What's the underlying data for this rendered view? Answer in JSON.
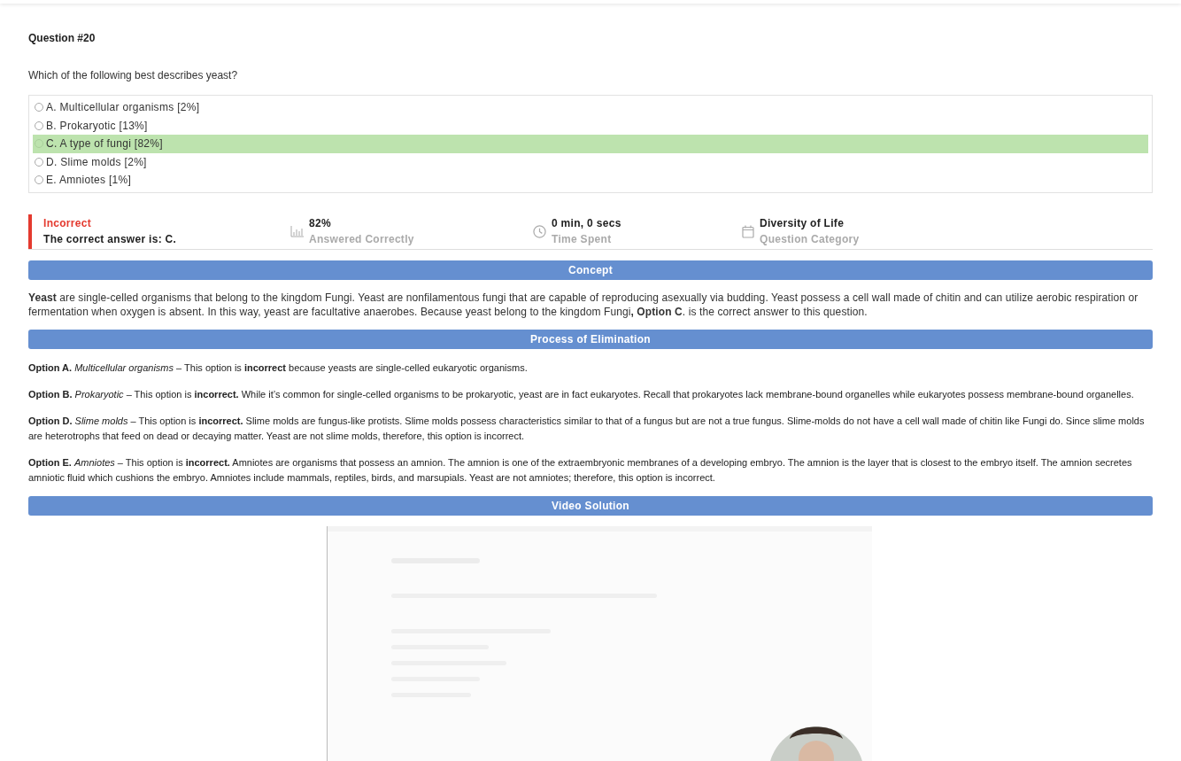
{
  "question": {
    "title": "Question #20",
    "prompt": "Which of the following best describes yeast?"
  },
  "options": [
    {
      "label": "A. Multicellular organisms [2%]",
      "selected": false,
      "correct": false
    },
    {
      "label": "B. Prokaryotic [13%]",
      "selected": false,
      "correct": false
    },
    {
      "label": "C. A type of fungi [82%]",
      "selected": false,
      "correct": true
    },
    {
      "label": "D. Slime molds [2%]",
      "selected": false,
      "correct": false
    },
    {
      "label": "E. Amniotes [1%]",
      "selected": false,
      "correct": false
    }
  ],
  "result": {
    "status": "Incorrect",
    "correct_answer": "The correct answer is: C."
  },
  "stats": [
    {
      "kind": "chart",
      "value": "82%",
      "caption": "Answered Correctly"
    },
    {
      "kind": "clock",
      "value": "0 min, 0 secs",
      "caption": "Time Spent"
    },
    {
      "kind": "calendar",
      "value": "Diversity of Life",
      "caption": "Question Category"
    }
  ],
  "sections": [
    {
      "title": "Concept",
      "kind": "concept",
      "paragraphs": [
        "**Yeast** are single-celled organisms that belong to the kingdom Fungi. Yeast are nonfilamentous fungi that are capable of reproducing asexually via budding. Yeast possess a cell wall made of chitin and can utilize aerobic respiration or fermentation when oxygen is absent. In this way, yeast are facultative anaerobes. Because yeast belong to the kingdom Fungi**, Option C**. is the correct answer to this question."
      ]
    },
    {
      "title": "Process of Elimination",
      "kind": "elimination",
      "paragraphs": [
        "**Option A.** *Multicellular organisms –* This option is **incorrect** because yeasts are single-celled eukaryotic organisms.",
        "**Option B.** *Prokaryotic –* This option is **incorrect.**  While it’s common for single-celled organisms to be prokaryotic, yeast are in fact eukaryotes. Recall that prokaryotes lack membrane-bound organelles while eukaryotes possess membrane-bound organelles.",
        "**Option D.** *Slime molds –* This option is **incorrect.**  Slime molds are fungus-like protists. Slime molds possess characteristics similar to that of a fungus but are not a true fungus. Slime-molds do not have a cell wall made of chitin like Fungi do. Since slime molds are heterotrophs that feed on dead or decaying matter. Yeast are not slime molds, therefore, this option is incorrect.",
        "**Option E.** *Amniotes –* This option is **incorrect.**  Amniotes are organisms that possess an amnion. The amnion is one of the extraembryonic membranes of a developing embryo. The amnion is the layer that is closest to the embryo itself. The amnion secretes amniotic fluid which cushions the embryo. Amniotes include mammals, reptiles, birds, and marsupials. Yeast are not amniotes; therefore, this option is incorrect."
      ]
    },
    {
      "title": "Video Solution",
      "kind": "video"
    }
  ]
}
